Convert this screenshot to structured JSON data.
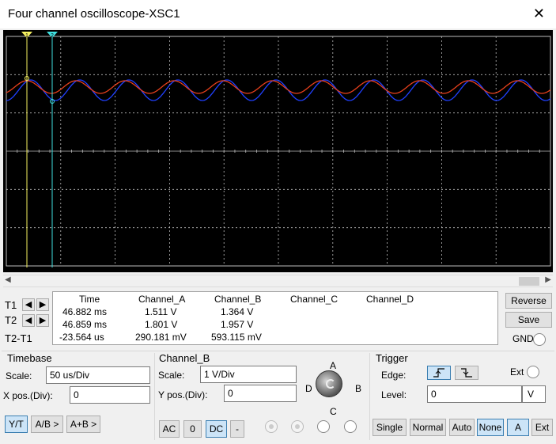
{
  "window": {
    "title": "Four channel oscilloscope-XSC1"
  },
  "measurements": {
    "headers": [
      "Time",
      "Channel_A",
      "Channel_B",
      "Channel_C",
      "Channel_D"
    ],
    "rows": [
      {
        "label": "T1",
        "time": "46.882 ms",
        "a": "1.511 V",
        "b": "1.364 V",
        "c": "",
        "d": ""
      },
      {
        "label": "T2",
        "time": "46.859 ms",
        "a": "1.801 V",
        "b": "1.957 V",
        "c": "",
        "d": ""
      },
      {
        "label": "T2-T1",
        "time": "-23.564 us",
        "a": "290.181 mV",
        "b": "593.115 mV",
        "c": "",
        "d": ""
      }
    ]
  },
  "buttons": {
    "reverse": "Reverse",
    "save": "Save",
    "gnd": "GND"
  },
  "timebase": {
    "title": "Timebase",
    "scale_label": "Scale:",
    "scale_value": "50 us/Div",
    "xpos_label": "X pos.(Div):",
    "xpos_value": "0",
    "modes": [
      "Y/T",
      "A/B >",
      "A+B >"
    ],
    "selected_mode": "Y/T"
  },
  "channel_b": {
    "title": "Channel_B",
    "scale_label": "Scale:",
    "scale_value": "1  V/Div",
    "ypos_label": "Y pos.(Div):",
    "ypos_value": "0",
    "coupling": [
      "AC",
      "0",
      "DC",
      "-"
    ],
    "selected_coupling": "DC"
  },
  "selector": {
    "a": "A",
    "b": "B",
    "c": "C",
    "d": "D"
  },
  "trigger": {
    "title": "Trigger",
    "edge_label": "Edge:",
    "ext_label": "Ext",
    "level_label": "Level:",
    "level_value": "0",
    "level_unit": "V",
    "modes": [
      "Single",
      "Normal",
      "Auto",
      "None",
      "A",
      "Ext"
    ]
  },
  "colors": {
    "channel_a": "#e8401c",
    "channel_b": "#2040ff",
    "cursor_1": "#f5f060",
    "cursor_2": "#40e0e0",
    "grid": "#bbbbbb",
    "screen_bg": "#000000"
  },
  "icons": {
    "close": "close-icon",
    "rising_edge": "rising-edge-icon",
    "falling_edge": "falling-edge-icon",
    "left_arrow": "left-arrow-icon",
    "right_arrow": "right-arrow-icon"
  }
}
